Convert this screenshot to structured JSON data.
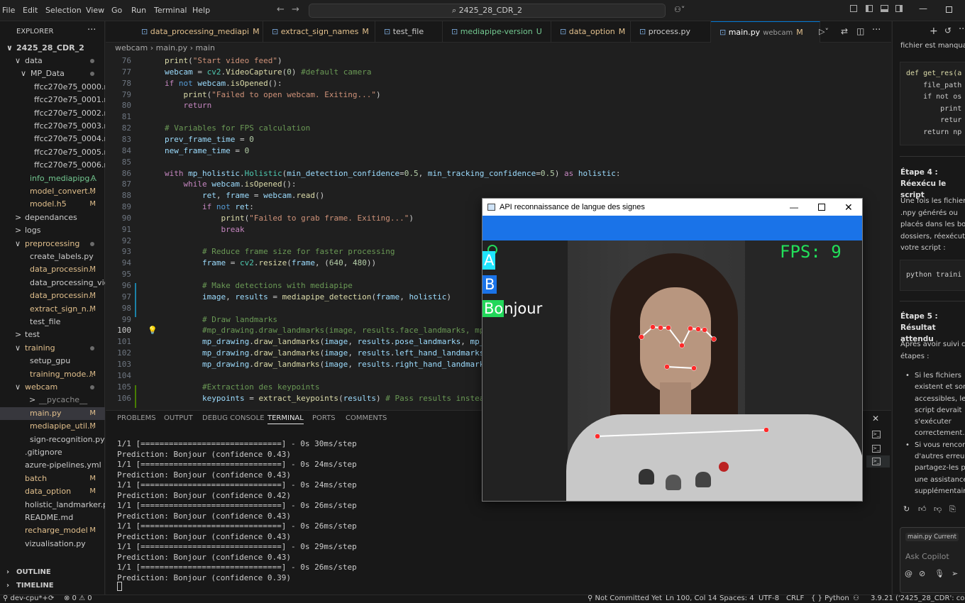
{
  "menu": [
    "File",
    "Edit",
    "Selection",
    "View",
    "Go",
    "Run",
    "Terminal",
    "Help"
  ],
  "search": {
    "text": "⌕ 2425_28_CDR_2"
  },
  "explorer": {
    "title": "EXPLORER",
    "project": "2425_28_CDR_2",
    "rows": [
      {
        "label": "data",
        "indent": 22,
        "chev": "∨",
        "color": "#cccccc",
        "badge": "",
        "dot": true
      },
      {
        "label": "MP_Data",
        "indent": 30,
        "chev": "∨",
        "color": "#cccccc",
        "badge": "",
        "dot": true
      },
      {
        "label": "ffcc270e75_0000.n...",
        "indent": 48,
        "chev": "",
        "color": "#cccccc",
        "badge": ""
      },
      {
        "label": "ffcc270e75_0001.n...",
        "indent": 48,
        "chev": "",
        "color": "#cccccc",
        "badge": ""
      },
      {
        "label": "ffcc270e75_0002.n...",
        "indent": 48,
        "chev": "",
        "color": "#cccccc",
        "badge": ""
      },
      {
        "label": "ffcc270e75_0003.n...",
        "indent": 48,
        "chev": "",
        "color": "#cccccc",
        "badge": ""
      },
      {
        "label": "ffcc270e75_0004.n...",
        "indent": 48,
        "chev": "",
        "color": "#cccccc",
        "badge": ""
      },
      {
        "label": "ffcc270e75_0005.n...",
        "indent": 48,
        "chev": "",
        "color": "#cccccc",
        "badge": ""
      },
      {
        "label": "ffcc270e75_0006.n...",
        "indent": 48,
        "chev": "",
        "color": "#cccccc",
        "badge": ""
      },
      {
        "label": "info_mediapipg...",
        "indent": 42,
        "chev": "",
        "color": "#73c991",
        "badge": "A"
      },
      {
        "label": "model_convert...",
        "indent": 42,
        "chev": "",
        "color": "#e2c08d",
        "badge": "M"
      },
      {
        "label": "model.h5",
        "indent": 42,
        "chev": "",
        "color": "#e2c08d",
        "badge": "M"
      },
      {
        "label": "dependances",
        "indent": 22,
        "chev": ">",
        "color": "#cccccc",
        "badge": ""
      },
      {
        "label": "logs",
        "indent": 22,
        "chev": ">",
        "color": "#cccccc",
        "badge": ""
      },
      {
        "label": "preprocessing",
        "indent": 22,
        "chev": "∨",
        "color": "#e2c08d",
        "badge": "",
        "dot": true
      },
      {
        "label": "create_labels.py",
        "indent": 42,
        "chev": "",
        "color": "#cccccc",
        "badge": ""
      },
      {
        "label": "data_processin...",
        "indent": 42,
        "chev": "",
        "color": "#e2c08d",
        "badge": "M"
      },
      {
        "label": "data_processing_vid...",
        "indent": 42,
        "chev": "",
        "color": "#cccccc",
        "badge": ""
      },
      {
        "label": "data_processin...",
        "indent": 42,
        "chev": "",
        "color": "#e2c08d",
        "badge": "M"
      },
      {
        "label": "extract_sign_n...",
        "indent": 42,
        "chev": "",
        "color": "#e2c08d",
        "badge": "M"
      },
      {
        "label": "test_file",
        "indent": 42,
        "chev": "",
        "color": "#cccccc",
        "badge": ""
      },
      {
        "label": "test",
        "indent": 22,
        "chev": ">",
        "color": "#cccccc",
        "badge": ""
      },
      {
        "label": "training",
        "indent": 22,
        "chev": "∨",
        "color": "#e2c08d",
        "badge": "",
        "dot": true
      },
      {
        "label": "setup_gpu",
        "indent": 42,
        "chev": "",
        "color": "#cccccc",
        "badge": ""
      },
      {
        "label": "training_mode...",
        "indent": 42,
        "chev": "",
        "color": "#e2c08d",
        "badge": "M"
      },
      {
        "label": "webcam",
        "indent": 22,
        "chev": "∨",
        "color": "#e2c08d",
        "badge": "",
        "dot": true
      },
      {
        "label": "__pycache__",
        "indent": 42,
        "chev": ">",
        "color": "#8b8b8b",
        "badge": ""
      },
      {
        "label": "main.py",
        "indent": 42,
        "chev": "",
        "color": "#e2c08d",
        "badge": "M",
        "selected": true
      },
      {
        "label": "mediapipe_util...",
        "indent": 42,
        "chev": "",
        "color": "#e2c08d",
        "badge": "M"
      },
      {
        "label": "sign-recognition.py",
        "indent": 42,
        "chev": "",
        "color": "#cccccc",
        "badge": ""
      },
      {
        "label": ".gitignore",
        "indent": 35,
        "chev": "",
        "color": "#cccccc",
        "badge": ""
      },
      {
        "label": "azure-pipelines.yml",
        "indent": 35,
        "chev": "",
        "color": "#cccccc",
        "badge": ""
      },
      {
        "label": "batch",
        "indent": 35,
        "chev": "",
        "color": "#e2c08d",
        "badge": "M"
      },
      {
        "label": "data_option",
        "indent": 35,
        "chev": "",
        "color": "#e2c08d",
        "badge": "M"
      },
      {
        "label": "holistic_landmarker.py",
        "indent": 35,
        "chev": "",
        "color": "#cccccc",
        "badge": ""
      },
      {
        "label": "README.md",
        "indent": 35,
        "chev": "",
        "color": "#cccccc",
        "badge": ""
      },
      {
        "label": "recharge_model",
        "indent": 35,
        "chev": "",
        "color": "#e2c08d",
        "badge": "M"
      },
      {
        "label": "vizualisation.py",
        "indent": 35,
        "chev": "",
        "color": "#cccccc",
        "badge": ""
      }
    ],
    "outline": "OUTLINE",
    "timeline": "TIMELINE"
  },
  "tabs": [
    {
      "label": "data_processing_mediapi",
      "badge": "M",
      "color": "#e2c08d"
    },
    {
      "label": "extract_sign_names",
      "badge": "M",
      "color": "#e2c08d"
    },
    {
      "label": "test_file",
      "badge": "",
      "color": "#cccccc"
    },
    {
      "label": "mediapipe-version",
      "badge": "U",
      "color": "#73c991"
    },
    {
      "label": "data_option",
      "badge": "M",
      "color": "#e2c08d"
    },
    {
      "label": "process.py",
      "badge": "",
      "color": "#cccccc"
    },
    {
      "label": "main.py",
      "badge": "M",
      "color": "#e2c08d",
      "active": true,
      "sub": "webcam"
    }
  ],
  "breadcrumb": "webcam  ›  main.py  ›  main",
  "code_lines": [
    {
      "n": "76",
      "html": "<span class='fn'>print</span>(<span class='str'>\"Start video feed\"</span>)"
    },
    {
      "n": "77",
      "html": "<span class='var'>webcam</span> = <span class='cls'>cv2</span>.<span class='fn'>VideoCapture</span>(<span class='num'>0</span>) <span class='cm'>#default camera</span>"
    },
    {
      "n": "78",
      "html": "<span class='kw'>if</span> <span class='bl'>not</span> <span class='var'>webcam</span>.<span class='fn'>isOpened</span>():"
    },
    {
      "n": "79",
      "html": "    <span class='fn'>print</span>(<span class='str'>\"Failed to open webcam. Exiting...\"</span>)"
    },
    {
      "n": "80",
      "html": "    <span class='kw'>return</span>"
    },
    {
      "n": "81",
      "html": ""
    },
    {
      "n": "82",
      "html": "<span class='cm'># Variables for FPS calculation</span>"
    },
    {
      "n": "83",
      "html": "<span class='var'>prev_frame_time</span> = <span class='num'>0</span>"
    },
    {
      "n": "84",
      "html": "<span class='var'>new_frame_time</span> = <span class='num'>0</span>"
    },
    {
      "n": "85",
      "html": ""
    },
    {
      "n": "86",
      "html": "<span class='kw'>with</span> <span class='var'>mp_holistic</span>.<span class='cls'>Holistic</span>(<span class='var'>min_detection_confidence</span>=<span class='num'>0.5</span>, <span class='var'>min_tracking_confidence</span>=<span class='num'>0.5</span>) <span class='kw'>as</span> <span class='var'>holistic</span>:"
    },
    {
      "n": "87",
      "html": "    <span class='kw'>while</span> <span class='var'>webcam</span>.<span class='fn'>isOpened</span>():"
    },
    {
      "n": "88",
      "html": "        <span class='var'>ret</span>, <span class='var'>frame</span> = <span class='var'>webcam</span>.<span class='fn'>read</span>()"
    },
    {
      "n": "89",
      "html": "        <span class='kw'>if</span> <span class='bl'>not</span> <span class='var'>ret</span>:"
    },
    {
      "n": "90",
      "html": "            <span class='fn'>print</span>(<span class='str'>\"Failed to grab frame. Exiting...\"</span>)"
    },
    {
      "n": "91",
      "html": "            <span class='kw'>break</span>"
    },
    {
      "n": "92",
      "html": ""
    },
    {
      "n": "93",
      "html": "        <span class='cm'># Reduce frame size for faster processing</span>"
    },
    {
      "n": "94",
      "html": "        <span class='var'>frame</span> = <span class='cls'>cv2</span>.<span class='fn'>resize</span>(<span class='var'>frame</span>, (<span class='num'>640</span>, <span class='num'>480</span>))"
    },
    {
      "n": "95",
      "html": ""
    },
    {
      "n": "96",
      "html": "        <span class='cm'># Make detections with mediapipe</span>"
    },
    {
      "n": "97",
      "html": "        <span class='var'>image</span>, <span class='var'>results</span> = <span class='fn'>mediapipe_detection</span>(<span class='var'>frame</span>, <span class='var'>holistic</span>)"
    },
    {
      "n": "98",
      "html": ""
    },
    {
      "n": "99",
      "html": "        <span class='cm'># Draw landmarks</span>"
    },
    {
      "n": "100",
      "html": "        <span class='cm'>#mp_drawing.draw_landmarks(image, results.face_landmarks, mp_</span>"
    },
    {
      "n": "101",
      "html": "        <span class='var'>mp_drawing</span>.<span class='fn'>draw_landmarks</span>(<span class='var'>image</span>, <span class='var'>results</span>.<span class='var'>pose_landmarks</span>, <span class='var'>mp_ho</span>"
    },
    {
      "n": "102",
      "html": "        <span class='var'>mp_drawing</span>.<span class='fn'>draw_landmarks</span>(<span class='var'>image</span>, <span class='var'>results</span>.<span class='var'>left_hand_landmarks</span>,"
    },
    {
      "n": "103",
      "html": "        <span class='var'>mp_drawing</span>.<span class='fn'>draw_landmarks</span>(<span class='var'>image</span>, <span class='var'>results</span>.<span class='var'>right_hand_landmarks</span>,"
    },
    {
      "n": "104",
      "html": ""
    },
    {
      "n": "105",
      "html": "        <span class='cm'>#Extraction des keypoints</span>"
    },
    {
      "n": "106",
      "html": "        <span class='var'>keypoints</span> = <span class='fn'>extract_keypoints</span>(<span class='var'>results</span>) <span class='cm'># Pass results instead</span>"
    }
  ],
  "panel": {
    "tabs": [
      "PROBLEMS",
      "OUTPUT",
      "DEBUG CONSOLE",
      "TERMINAL",
      "PORTS",
      "COMMENTS"
    ],
    "active_tab": "TERMINAL",
    "lines": [
      "1/1 [==============================] - 0s 30ms/step",
      "Prediction: Bonjour (confidence 0.43)",
      "1/1 [==============================] - 0s 24ms/step",
      "Prediction: Bonjour (confidence 0.43)",
      "1/1 [==============================] - 0s 24ms/step",
      "Prediction: Bonjour (confidence 0.42)",
      "1/1 [==============================] - 0s 26ms/step",
      "Prediction: Bonjour (confidence 0.43)",
      "1/1 [==============================] - 0s 26ms/step",
      "Prediction: Bonjour (confidence 0.43)",
      "1/1 [==============================] - 0s 29ms/step",
      "Prediction: Bonjour (confidence 0.43)",
      "1/1 [==============================] - 0s 26ms/step",
      "Prediction: Bonjour (confidence 0.39)"
    ]
  },
  "copilot": {
    "intro": "fichier est manquar",
    "code": [
      "def get_res(a",
      "    file_path",
      "    if not os",
      "        print",
      "        retur",
      "    return np"
    ],
    "step4_title": "Étape 4 : Réexécu le script",
    "step4_text": [
      "Une fois les fichiers",
      ".npy générés ou",
      "placés dans les bon",
      "dossiers, réexécutez",
      "votre script :"
    ],
    "cmd": "python traini",
    "step5_title": "Étape 5 : Résultat attendu",
    "step5_text": [
      "Après avoir suivi ce",
      "étapes :"
    ],
    "bullets": [
      [
        "Si les fichiers ",
        "existent et sont",
        "accessibles, le",
        "script devrait",
        "s'exécuter",
        "correctement."
      ],
      [
        "Si vous renconti",
        "d'autres erreurs",
        "partagez-les po",
        "une assistance",
        "supplémentaire"
      ]
    ],
    "chip": "main.py Current",
    "ask": "Ask Copilot"
  },
  "cv_window": {
    "title": "API reconnaissance de langue des signes",
    "fps": "FPS: 9",
    "letters": [
      {
        "text": "A",
        "bg": "#1fe4ff"
      },
      {
        "text": "B",
        "bg": "#1a73e8"
      },
      {
        "text": "Bonjour",
        "bg": "#22d85a"
      }
    ]
  },
  "status": {
    "remote": "dev-cpu*+",
    "errors": "⊗ 0 ⚠ 0",
    "git": "Not Committed Yet",
    "pos": "Ln 100, Col 14",
    "spaces": "Spaces: 4",
    "enc": "UTF-8",
    "eol": "CRLF",
    "lang": "{ } Python",
    "interp": "3.9.21 ('2425_28_CDR': conda)"
  }
}
